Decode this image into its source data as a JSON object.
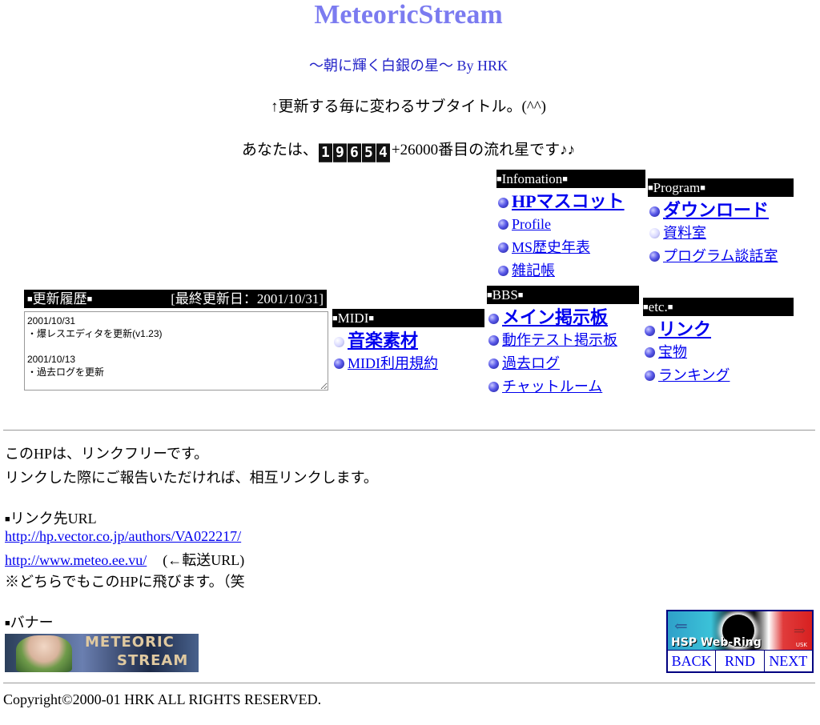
{
  "header": {
    "title": "MeteoricStream",
    "subtitle": "〜朝に輝く白銀の星〜 By HRK",
    "rotating_subtitle": "↑更新する毎に変わるサブタイトル。(^^)",
    "visitor_prefix": "あなたは、",
    "counter_digits": [
      "1",
      "9",
      "6",
      "5",
      "4"
    ],
    "visitor_suffix": "+26000番目の流れ星です♪♪"
  },
  "updates": {
    "header_label": "更新履歴",
    "last_updated": "[最終更新日：2001/10/31]",
    "log": "2001/10/31\n・爆レスエディタを更新(v1.23)\n\n2001/10/13\n・過去ログを更新"
  },
  "sections": {
    "midi": {
      "label": "MIDI",
      "items": [
        {
          "label": "音楽素材"
        },
        {
          "label": "MIDI利用規約"
        }
      ]
    },
    "info": {
      "label": "Infomation",
      "items": [
        {
          "label": "HPマスコット"
        },
        {
          "label": "Profile"
        },
        {
          "label": "MS歴史年表"
        },
        {
          "label": "雑記帳"
        }
      ]
    },
    "bbs": {
      "label": "BBS",
      "items": [
        {
          "label": "メイン掲示板"
        },
        {
          "label": "動作テスト掲示板"
        },
        {
          "label": "過去ログ"
        },
        {
          "label": "チャットルーム"
        }
      ]
    },
    "program": {
      "label": "Program",
      "items": [
        {
          "label": "ダウンロード"
        },
        {
          "label": "資料室"
        },
        {
          "label": "プログラム談話室"
        }
      ]
    },
    "etc": {
      "label": "etc.",
      "items": [
        {
          "label": "リンク"
        },
        {
          "label": "宝物"
        },
        {
          "label": "ランキング"
        }
      ]
    }
  },
  "link_info": {
    "line1": "このHPは、リンクフリーです。",
    "line2": "リンクした際にご報告いただければ、相互リンクします。",
    "urls_heading": "リンク先URL",
    "url1": "http://hp.vector.co.jp/authors/VA022217/",
    "url2": "http://www.meteo.ee.vu/",
    "url2_note": "(←転送URL)",
    "note": "※どちらでもこのHPに飛びます。（笑",
    "banner_heading": "バナー"
  },
  "banner": {
    "text1": "METEORIC",
    "text2": "STREAM"
  },
  "webring": {
    "logo_text": "HSP Web-Ring",
    "logo_tag": "USK",
    "back": "BACK",
    "random": "RND",
    "next": "NEXT"
  },
  "footer": {
    "copyright": "Copyright©2000-01 HRK ALL RIGHTS RESERVED."
  },
  "icons": {
    "bullet": "blue-sphere-icon",
    "bullet_pale": "pale-sphere-icon",
    "square": "black-square-icon"
  }
}
